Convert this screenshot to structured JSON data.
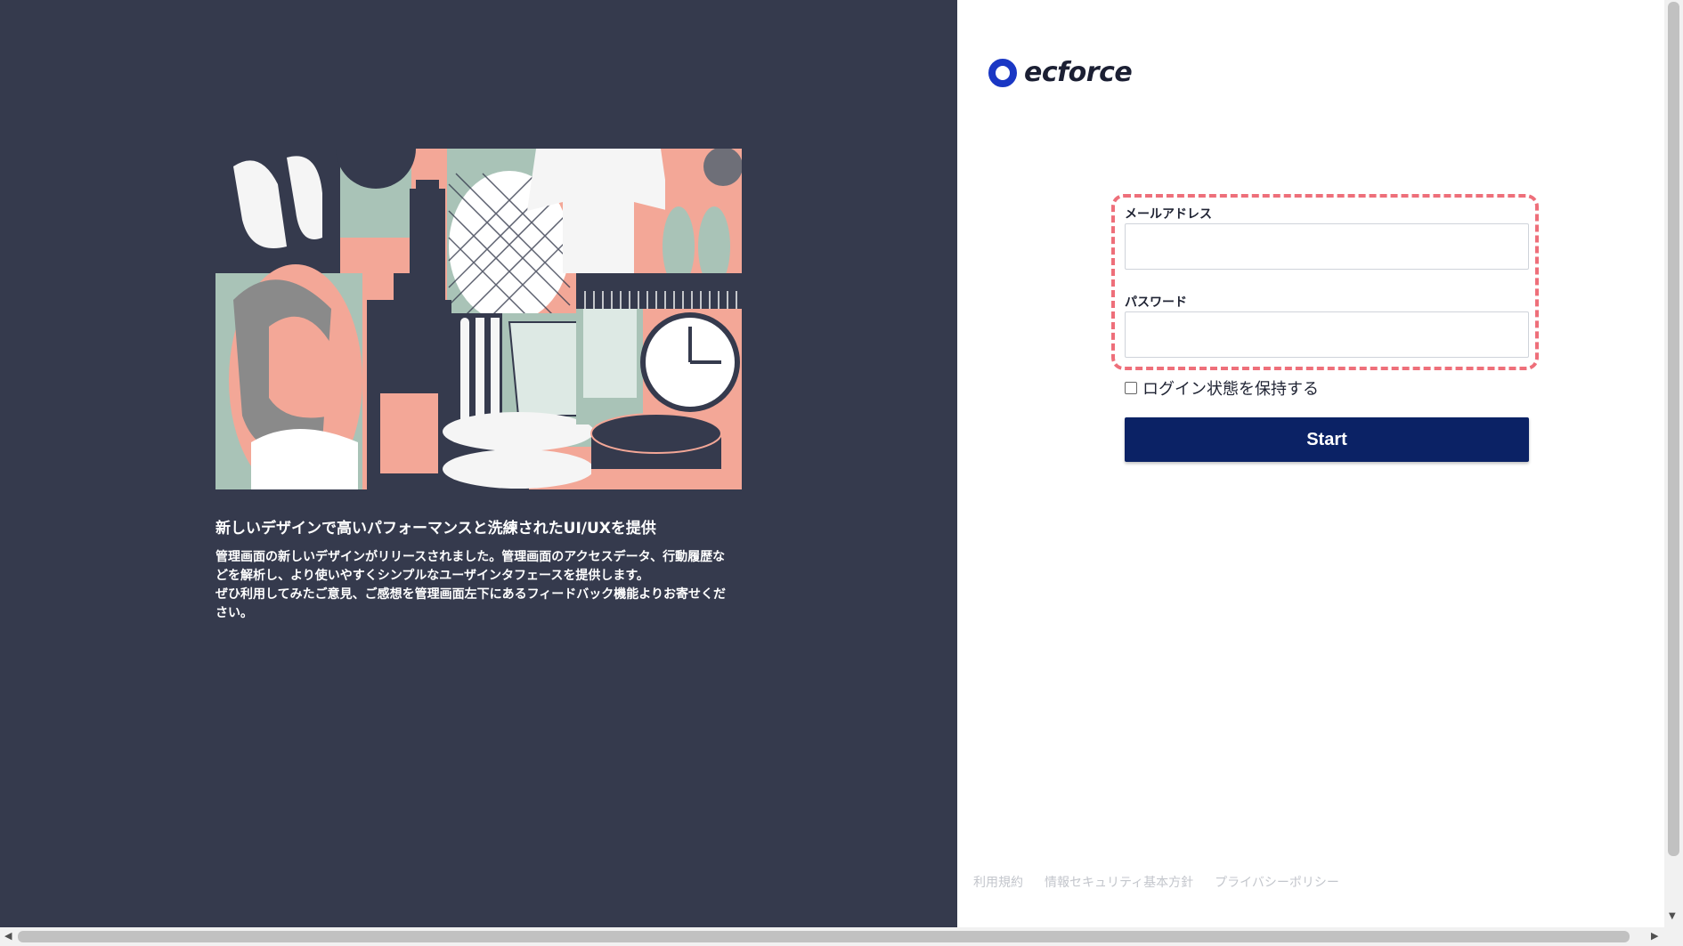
{
  "brand": {
    "name": "ecforce",
    "color": "#1a37c4"
  },
  "promo": {
    "heading": "新しいデザインで高いパフォーマンスと洗練されたUI/UXを提供",
    "body_lines": [
      "管理画面の新しいデザインがリリースされました。管理画面のアクセスデータ、行動履歴な",
      "どを解析し、より使いやすくシンプルなユーザインタフェースを提供します。",
      "ぜひ利用してみたご意見、ご感想を管理画面左下にあるフィードバック機能よりお寄せくだ",
      "さい。"
    ]
  },
  "login": {
    "email_label": "メールアドレス",
    "email_value": "",
    "password_label": "パスワード",
    "password_value": "",
    "remember_label": "ログイン状態を保持する",
    "remember_checked": false,
    "submit_label": "Start"
  },
  "footer": {
    "links": [
      "利用規約",
      "情報セキュリティ基本方針",
      "プライバシーポリシー"
    ]
  },
  "colors": {
    "left_panel_bg": "#353a4d",
    "submit_bg": "#0b2265",
    "highlight_border": "#ee6f7a"
  }
}
